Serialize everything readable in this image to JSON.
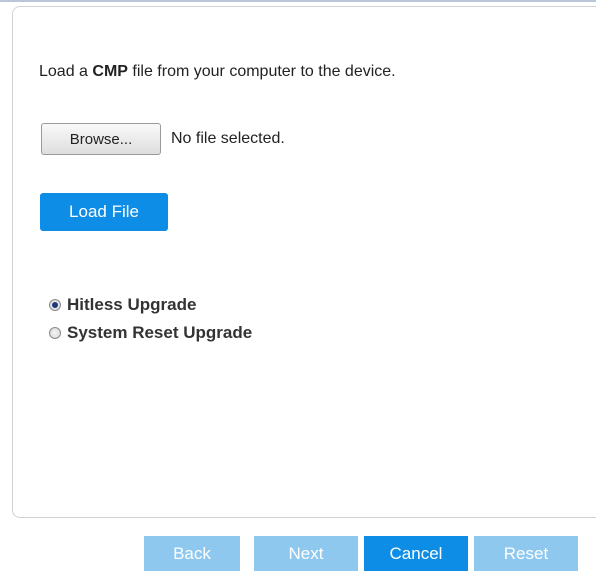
{
  "instructions": {
    "prefix": "Load a ",
    "highlight": "CMP",
    "suffix": " file from your computer to the device."
  },
  "file_picker": {
    "browse_label": "Browse...",
    "status": "No file selected."
  },
  "load_button": "Load File",
  "upgrade_options": [
    {
      "label": "Hitless Upgrade",
      "checked": true
    },
    {
      "label": "System Reset Upgrade",
      "checked": false
    }
  ],
  "footer": {
    "back": "Back",
    "next": "Next",
    "cancel": "Cancel",
    "reset": "Reset"
  },
  "colors": {
    "primary": "#0d8de6",
    "disabled": "#8ec8ef"
  }
}
